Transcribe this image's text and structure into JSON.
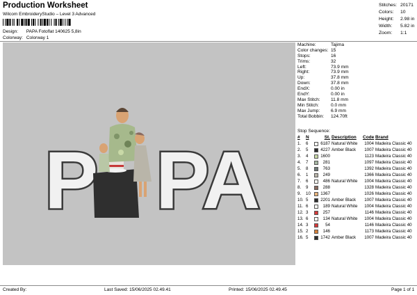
{
  "header": {
    "title": "Production Worksheet",
    "subtitle": "Wilcom EmbroideryStudio – Level 3 Advanced",
    "design_label": "Design:",
    "design_value": "PAPA Fotoflat 140625 5,8in",
    "colorway_label": "Colorway:",
    "colorway_value": "Colorway 1"
  },
  "top_stats": [
    {
      "label": "Stitches:",
      "value": "20171"
    },
    {
      "label": "Colors:",
      "value": "10"
    },
    {
      "label": "Height:",
      "value": "2.98 in"
    },
    {
      "label": "Width:",
      "value": "5.82 in"
    },
    {
      "label": "Zoom:",
      "value": "1:1"
    }
  ],
  "design": {
    "letters": [
      "P",
      "PA"
    ]
  },
  "machine_info": [
    {
      "label": "Machine:",
      "value": "Tajima"
    },
    {
      "label": "Color changes:",
      "value": "15"
    },
    {
      "label": "Stops:",
      "value": "16"
    },
    {
      "label": "Trims:",
      "value": "32"
    },
    {
      "label": "Left:",
      "value": "73.9 mm"
    },
    {
      "label": "Right:",
      "value": "73.9 mm"
    },
    {
      "label": "Up:",
      "value": "37.8 mm"
    },
    {
      "label": "Down:",
      "value": "37.8 mm"
    },
    {
      "label": "EndX:",
      "value": "0.00 in"
    },
    {
      "label": "EndY:",
      "value": "0.00 in"
    },
    {
      "label": "Max Stitch:",
      "value": "11.8 mm"
    },
    {
      "label": "Min Stitch:",
      "value": "0.0 mm"
    },
    {
      "label": "Max Jump:",
      "value": "6.9 mm"
    },
    {
      "label": "Total Bobbin:",
      "value": "124.70ft"
    }
  ],
  "stop_sequence": {
    "title": "Stop Sequence:",
    "headers": {
      "no": "#",
      "n": "N",
      "st": "St.",
      "desc": "Description",
      "code": "Code",
      "brand": "Brand"
    },
    "rows": [
      {
        "no": "1.",
        "n": "6",
        "color": "#f7f7f2",
        "st": "6187",
        "desc": "Natural White",
        "code": "1004",
        "brand": "Madeira Classic 40"
      },
      {
        "no": "2.",
        "n": "5",
        "color": "#2e2e2e",
        "st": "4227",
        "desc": "Amber Black",
        "code": "1007",
        "brand": "Madeira Classic 40"
      },
      {
        "no": "3.",
        "n": "4",
        "color": "#c9d9a7",
        "st": "1600",
        "desc": "",
        "code": "1123",
        "brand": "Madeira Classic 40"
      },
      {
        "no": "4.",
        "n": "7",
        "color": "#a7b8a4",
        "st": "281",
        "desc": "",
        "code": "1097",
        "brand": "Madeira Classic 40"
      },
      {
        "no": "5.",
        "n": "8",
        "color": "#6f7a78",
        "st": "763",
        "desc": "",
        "code": "1392",
        "brand": "Madeira Classic 40"
      },
      {
        "no": "6.",
        "n": "1",
        "color": "#b9b5a9",
        "st": "249",
        "desc": "",
        "code": "1366",
        "brand": "Madeira Classic 40"
      },
      {
        "no": "7.",
        "n": "6",
        "color": "#f7f7f2",
        "st": "486",
        "desc": "Natural White",
        "code": "1004",
        "brand": "Madeira Classic 40"
      },
      {
        "no": "8.",
        "n": "9",
        "color": "#8a6a5f",
        "st": "288",
        "desc": "",
        "code": "1328",
        "brand": "Madeira Classic 40"
      },
      {
        "no": "9.",
        "n": "10",
        "color": "#e8b47c",
        "st": "1367",
        "desc": "",
        "code": "1026",
        "brand": "Madeira Classic 40"
      },
      {
        "no": "10.",
        "n": "5",
        "color": "#2e2e2e",
        "st": "2201",
        "desc": "Amber Black",
        "code": "1007",
        "brand": "Madeira Classic 40"
      },
      {
        "no": "11.",
        "n": "6",
        "color": "#f7f7f2",
        "st": "189",
        "desc": "Natural White",
        "code": "1004",
        "brand": "Madeira Classic 40"
      },
      {
        "no": "12.",
        "n": "3",
        "color": "#d53a3a",
        "st": "257",
        "desc": "",
        "code": "1146",
        "brand": "Madeira Classic 40"
      },
      {
        "no": "13.",
        "n": "6",
        "color": "#f7f7f2",
        "st": "134",
        "desc": "Natural White",
        "code": "1004",
        "brand": "Madeira Classic 40"
      },
      {
        "no": "14.",
        "n": "3",
        "color": "#d53a3a",
        "st": "54",
        "desc": "",
        "code": "1146",
        "brand": "Madeira Classic 40"
      },
      {
        "no": "15.",
        "n": "2",
        "color": "#d5803a",
        "st": "146",
        "desc": "",
        "code": "1173",
        "brand": "Madeira Classic 40"
      },
      {
        "no": "16.",
        "n": "5",
        "color": "#2e2e2e",
        "st": "1742",
        "desc": "Amber Black",
        "code": "1007",
        "brand": "Madeira Classic 40"
      }
    ]
  },
  "footer": {
    "created_by": "Created By:",
    "last_saved": "Last Saved: 15/06/2025 02.49.41",
    "printed": "Printed: 15/06/2025 02.49.45",
    "page": "Page 1 of 1"
  }
}
